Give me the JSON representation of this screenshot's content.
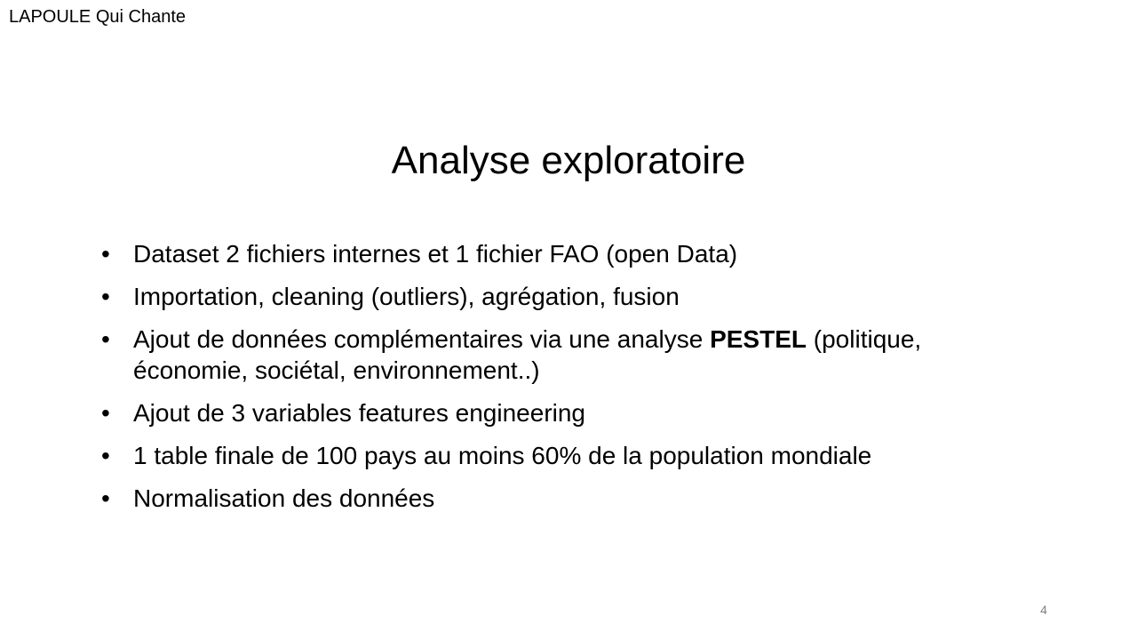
{
  "header": {
    "text": "LAPOULE Qui Chante"
  },
  "slide": {
    "title": "Analyse exploratoire",
    "bullet_symbol": "•",
    "bullets": [
      {
        "text": "Dataset 2 fichiers internes et 1 fichier FAO (open Data)"
      },
      {
        "text": "Importation, cleaning (outliers), agrégation, fusion"
      },
      {
        "before": "Ajout de données complémentaires via une analyse ",
        "strong": "PESTEL",
        "after": " (politique, économie, sociétal, environnement..)"
      },
      {
        "text": "Ajout de 3 variables features engineering"
      },
      {
        "text": "1 table finale de 100 pays au moins 60% de la population mondiale"
      },
      {
        "text": "Normalisation des données"
      }
    ],
    "page_number": "4"
  }
}
